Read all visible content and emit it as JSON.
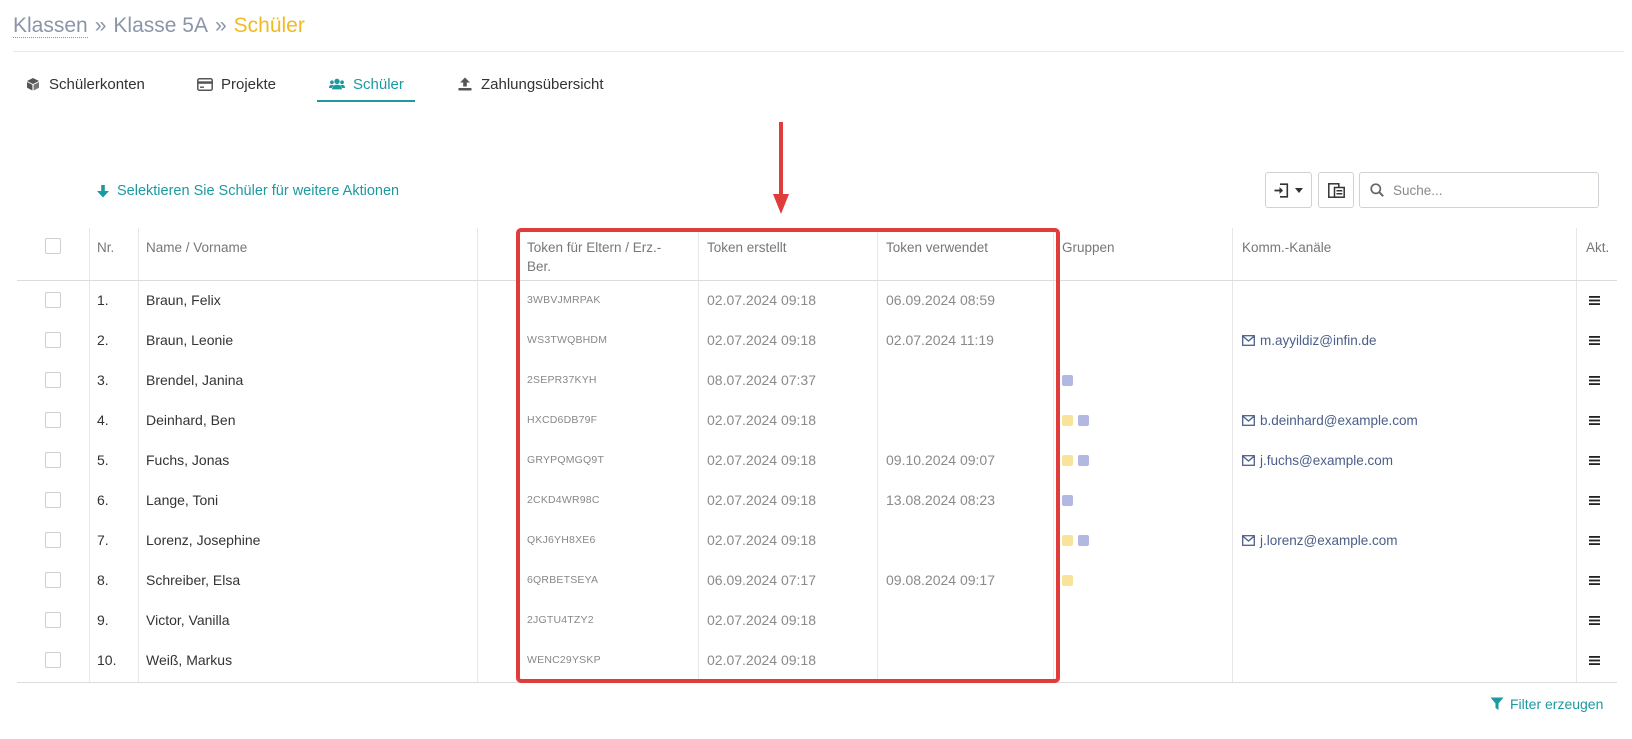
{
  "breadcrumb": {
    "items": [
      "Klassen",
      "Klasse 5A"
    ],
    "separator": "»",
    "current": "Schüler"
  },
  "tabs": [
    {
      "label": "Schülerkonten",
      "icon": "cube-icon"
    },
    {
      "label": "Projekte",
      "icon": "credit-card-icon"
    },
    {
      "label": "Schüler",
      "icon": "users-icon",
      "active": true
    },
    {
      "label": "Zahlungsübersicht",
      "icon": "upload-icon"
    }
  ],
  "toolbar": {
    "select_hint": "Selektieren Sie Schüler für weitere Aktionen",
    "search_placeholder": "Suche..."
  },
  "table": {
    "headers": {
      "nr": "Nr.",
      "name": "Name / Vorname",
      "token": "Token für Eltern / Erz.-Ber.",
      "created": "Token erstellt",
      "used": "Token verwendet",
      "groups": "Gruppen",
      "comm": "Komm.-Kanäle",
      "act": "Akt."
    },
    "rows": [
      {
        "nr": "1.",
        "name": "Braun, Felix",
        "token": "3WBVJMRPAK",
        "created": "02.07.2024 09:18",
        "used": "06.09.2024 08:59",
        "groups": [],
        "email": ""
      },
      {
        "nr": "2.",
        "name": "Braun, Leonie",
        "token": "WS3TWQBHDM",
        "created": "02.07.2024 09:18",
        "used": "02.07.2024 11:19",
        "groups": [],
        "email": "m.ayyildiz@infin.de"
      },
      {
        "nr": "3.",
        "name": "Brendel, Janina",
        "token": "2SEPR37KYH",
        "created": "08.07.2024 07:37",
        "used": "",
        "groups": [
          "#b3b8e3"
        ],
        "email": ""
      },
      {
        "nr": "4.",
        "name": "Deinhard, Ben",
        "token": "HXCD6DB79F",
        "created": "02.07.2024 09:18",
        "used": "",
        "groups": [
          "#f9e39a",
          "#b3b8e3"
        ],
        "email": "b.deinhard@example.com"
      },
      {
        "nr": "5.",
        "name": "Fuchs, Jonas",
        "token": "GRYPQMGQ9T",
        "created": "02.07.2024 09:18",
        "used": "09.10.2024 09:07",
        "groups": [
          "#f9e39a",
          "#b3b8e3"
        ],
        "email": "j.fuchs@example.com"
      },
      {
        "nr": "6.",
        "name": "Lange, Toni",
        "token": "2CKD4WR98C",
        "created": "02.07.2024 09:18",
        "used": "13.08.2024 08:23",
        "groups": [
          "#b3b8e3"
        ],
        "email": ""
      },
      {
        "nr": "7.",
        "name": "Lorenz, Josephine",
        "token": "QKJ6YH8XE6",
        "created": "02.07.2024 09:18",
        "used": "",
        "groups": [
          "#f9e39a",
          "#b3b8e3"
        ],
        "email": "j.lorenz@example.com"
      },
      {
        "nr": "8.",
        "name": "Schreiber, Elsa",
        "token": "6QRBETSEYA",
        "created": "06.09.2024 07:17",
        "used": "09.08.2024 09:17",
        "groups": [
          "#f9e39a"
        ],
        "email": ""
      },
      {
        "nr": "9.",
        "name": "Victor, Vanilla",
        "token": "2JGTU4TZY2",
        "created": "02.07.2024 09:18",
        "used": "",
        "groups": [],
        "email": ""
      },
      {
        "nr": "10.",
        "name": "Weiß, Markus",
        "token": "WENC29YSKP",
        "created": "02.07.2024 09:18",
        "used": "",
        "groups": [],
        "email": ""
      }
    ]
  },
  "footer": {
    "filter_label": "Filter erzeugen"
  },
  "colors": {
    "accent": "#1b9aa0",
    "breadcrumb_current": "#f2b924",
    "highlight": "#e03c3c"
  }
}
